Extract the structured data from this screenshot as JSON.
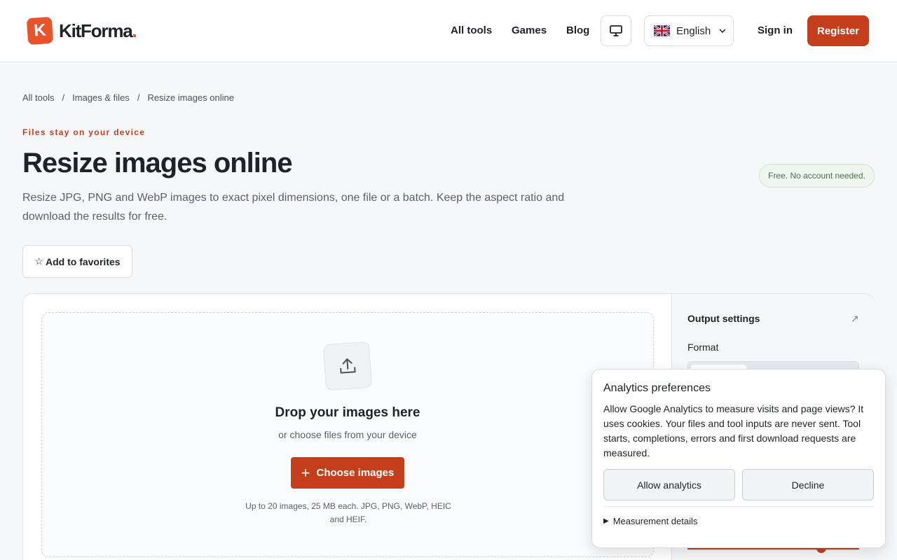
{
  "header": {
    "brand": "KitForma",
    "brand_dot": ".",
    "logo_letter": "K",
    "nav": [
      "All tools",
      "Games",
      "Blog"
    ],
    "language": "English",
    "sign_in": "Sign in",
    "register": "Register"
  },
  "breadcrumb": [
    "All tools",
    "Images & files",
    "Resize images online"
  ],
  "breadcrumb_sep": "/",
  "hero": {
    "eyebrow": "Files stay on your device",
    "title": "Resize images online",
    "badge": "Free. No account needed.",
    "description": "Resize JPG, PNG and WebP images to exact pixel dimensions, one file or a batch. Keep the aspect ratio and download the results for free.",
    "favorite_star": "☆",
    "favorite_label": "Add to favorites"
  },
  "dropzone": {
    "title": "Drop your images here",
    "subtitle": "or choose files from your device",
    "button": "Choose images",
    "button_icon": "+",
    "note": "Up to 20 images, 25 MB each. JPG, PNG, WebP, HEIC and HEIF."
  },
  "output_settings": {
    "title": "Output settings",
    "expand_icon": "↗",
    "format_label": "Format"
  },
  "consent": {
    "title": "Analytics preferences",
    "text": "Allow Google Analytics to measure visits and page views? It uses cookies. Your files and tool inputs are never sent. Tool starts, completions, errors and first download requests are measured.",
    "allow": "Allow analytics",
    "decline": "Decline",
    "details_marker": "▶",
    "details": "Measurement details"
  },
  "colors": {
    "accent": "#c43e1c",
    "logo": "#e8532a",
    "badge_bg": "#eef6ef",
    "background": "#f6f7f9"
  }
}
